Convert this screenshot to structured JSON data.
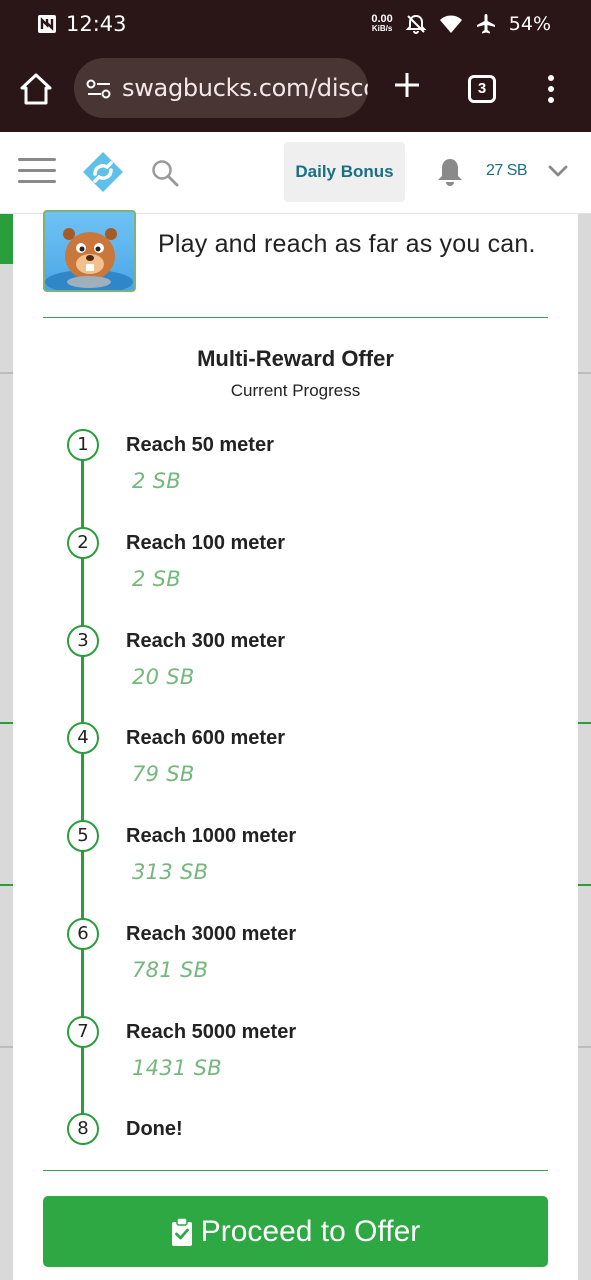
{
  "status_bar": {
    "time": "12:43",
    "net_speed_value": "0.00",
    "net_speed_unit": "KiB/s",
    "battery": "54%"
  },
  "browser": {
    "url": "swagbucks.com/discover",
    "tab_count": "3"
  },
  "header": {
    "daily_bonus_label": "Daily Bonus",
    "balance": "27 SB",
    "accent_color": "#1b6f85"
  },
  "offer": {
    "description": "Play and reach as far as you can.",
    "title": "Multi-Reward Offer",
    "subtitle": "Current Progress",
    "steps": [
      {
        "num": "1",
        "title": "Reach 50 meter",
        "reward": "2 SB"
      },
      {
        "num": "2",
        "title": "Reach 100 meter",
        "reward": "2 SB"
      },
      {
        "num": "3",
        "title": "Reach 300 meter",
        "reward": "20 SB"
      },
      {
        "num": "4",
        "title": "Reach 600 meter",
        "reward": "79 SB"
      },
      {
        "num": "5",
        "title": "Reach 1000 meter",
        "reward": "313 SB"
      },
      {
        "num": "6",
        "title": "Reach 3000 meter",
        "reward": "781 SB"
      },
      {
        "num": "7",
        "title": "Reach 5000 meter",
        "reward": "1431 SB"
      },
      {
        "num": "8",
        "title": "Done!",
        "reward": ""
      }
    ],
    "proceed_label": "Proceed to Offer",
    "brand_green": "#2ea843"
  },
  "icons": [
    "home-icon",
    "site-settings-icon",
    "plus-icon",
    "more-vert-icon",
    "hamburger-icon",
    "swagbucks-logo-icon",
    "search-icon",
    "bell-icon",
    "chevron-down-icon",
    "clipboard-check-icon"
  ]
}
